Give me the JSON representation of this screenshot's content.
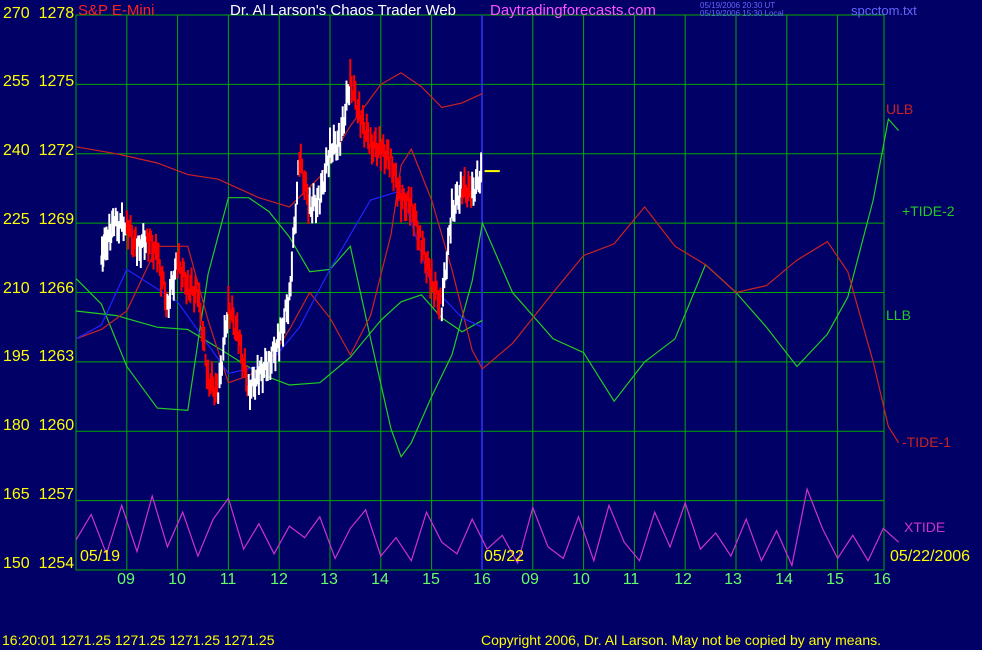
{
  "header": {
    "instrument": "S&P E-Mini",
    "title": "Dr. Al Larson's Chaos Trader Web",
    "site": "Daytradingforecasts.com",
    "stamp_line1": "05/19/2006 20:30 UT",
    "stamp_line2": "05/19/2006 15:30 Local",
    "file": "spcctom.txt"
  },
  "footer": {
    "status": "16:20:01  1271.25 1271.25 1271.25 1271.25",
    "copyright": "Copyright 2006, Dr. Al Larson. May not be copied by any means."
  },
  "colors": {
    "background": "#000066",
    "grid": "#00aa00",
    "axis_text": "#ffff00",
    "time_text": "#66ff66",
    "price_bar_up": "#ffffff",
    "price_bar_down": "#ff0000",
    "ulb": "#cc2222",
    "llb": "#22cc22",
    "tide_minus_1": "#cc2222",
    "tide_plus_2": "#22cc22",
    "xtide": "#cc33cc",
    "average": "#2222ff"
  },
  "chart_data": {
    "type": "line",
    "title": "Dr. Al Larson's Chaos Trader Web",
    "grid": true,
    "y_ticks": [
      {
        "osc": "270",
        "price": "1278"
      },
      {
        "osc": "255",
        "price": "1275"
      },
      {
        "osc": "240",
        "price": "1272"
      },
      {
        "osc": "225",
        "price": "1269"
      },
      {
        "osc": "210",
        "price": "1266"
      },
      {
        "osc": "195",
        "price": "1263"
      },
      {
        "osc": "180",
        "price": "1260"
      },
      {
        "osc": "165",
        "price": "1257"
      },
      {
        "osc": "150",
        "price": "1254"
      }
    ],
    "ylim_price": [
      1254,
      1278
    ],
    "x_ticks": [
      "09",
      "10",
      "11",
      "12",
      "13",
      "14",
      "15",
      "16",
      "09",
      "10",
      "11",
      "12",
      "13",
      "14",
      "15",
      "16"
    ],
    "dates": {
      "start": "05/19",
      "mid": "05/22",
      "end": "05/22/2006"
    },
    "right_labels": {
      "ulb": "ULB",
      "tide_plus_2": "+TIDE-2",
      "llb": "LLB",
      "tide_minus_1": "-TIDE-1",
      "xtide": "XTIDE"
    },
    "last_price": 1271.25,
    "price_close": {
      "hours": [
        8.5,
        8.6,
        8.75,
        9.0,
        9.2,
        9.4,
        9.6,
        9.8,
        10.0,
        10.2,
        10.4,
        10.6,
        10.8,
        11.0,
        11.2,
        11.4,
        11.6,
        11.8,
        12.0,
        12.2,
        12.4,
        12.6,
        12.8,
        13.0,
        13.2,
        13.4,
        13.6,
        13.8,
        14.0,
        14.2,
        14.4,
        14.6,
        14.8,
        15.0,
        15.2,
        15.4,
        15.6,
        15.8,
        16.0
      ],
      "prices": [
        1267.4,
        1268.2,
        1268.9,
        1269.0,
        1267.8,
        1268.4,
        1267.6,
        1265.5,
        1267.3,
        1266.3,
        1265.9,
        1262.3,
        1261.6,
        1265.5,
        1264.0,
        1261.8,
        1262.4,
        1263.0,
        1263.9,
        1265.8,
        1271.8,
        1269.7,
        1270.0,
        1272.2,
        1272.5,
        1275.2,
        1273.5,
        1272.4,
        1272.2,
        1271.7,
        1270.0,
        1269.8,
        1268.1,
        1266.5,
        1265.4,
        1269.5,
        1270.5,
        1270.3,
        1271.25
      ]
    },
    "series": [
      {
        "name": "ULB",
        "hours": [
          8.0,
          8.8,
          9.6,
          10.2,
          10.8,
          11.6,
          12.2,
          12.8,
          13.4,
          14.0,
          14.4,
          14.8,
          15.2,
          15.6,
          16.0
        ],
        "values": [
          1272.3,
          1272.0,
          1271.6,
          1271.1,
          1270.9,
          1270.1,
          1269.7,
          1271.0,
          1273.2,
          1275.0,
          1275.5,
          1274.9,
          1274.0,
          1274.2,
          1274.6
        ]
      },
      {
        "name": "LLB",
        "hours": [
          8.0,
          8.8,
          9.6,
          10.2,
          10.8,
          11.6,
          12.2,
          12.8,
          13.4,
          14.0,
          14.4,
          14.8,
          15.2,
          15.6,
          16.0
        ],
        "values": [
          1265.2,
          1265.0,
          1264.5,
          1264.4,
          1263.6,
          1262.5,
          1262.0,
          1262.1,
          1263.2,
          1264.8,
          1265.6,
          1265.9,
          1264.9,
          1264.3,
          1264.8
        ]
      },
      {
        "name": "+TIDE-2",
        "hours": [
          8.0,
          8.5,
          9.0,
          9.6,
          10.2,
          10.6,
          11.0,
          11.4,
          11.8,
          12.2,
          12.6,
          13.0,
          13.4,
          13.8,
          14.2,
          14.4,
          14.6,
          15.0,
          15.4,
          15.8,
          16.0,
          16.6,
          17.4,
          18.0,
          18.6,
          19.2,
          19.8,
          20.4,
          21.0,
          21.6,
          22.2,
          22.8,
          23.2,
          23.7,
          24.0,
          24.2
        ],
        "values": [
          1266.6,
          1265.5,
          1262.8,
          1261.0,
          1260.9,
          1266.8,
          1270.1,
          1270.1,
          1269.5,
          1268.4,
          1266.9,
          1267.0,
          1268.0,
          1264.0,
          1260.1,
          1258.9,
          1259.5,
          1261.5,
          1263.3,
          1266.5,
          1269.0,
          1266.0,
          1264.0,
          1263.4,
          1261.3,
          1263.0,
          1264.0,
          1267.2,
          1266.0,
          1264.5,
          1262.8,
          1264.2,
          1265.8,
          1270.0,
          1273.5,
          1273.0
        ]
      },
      {
        "name": "-TIDE-1",
        "hours": [
          8.0,
          8.5,
          9.0,
          9.6,
          10.2,
          10.6,
          11.0,
          11.4,
          11.8,
          12.2,
          12.6,
          13.0,
          13.4,
          13.8,
          14.2,
          14.4,
          14.6,
          15.0,
          15.4,
          15.8,
          16.0,
          16.6,
          17.4,
          18.0,
          18.6,
          19.2,
          19.8,
          20.4,
          21.0,
          21.6,
          22.2,
          22.8,
          23.2,
          23.7,
          24.0,
          24.2
        ],
        "values": [
          1264.0,
          1264.4,
          1265.2,
          1268.0,
          1268.0,
          1264.8,
          1262.1,
          1262.4,
          1263.0,
          1264.4,
          1266.0,
          1264.9,
          1263.3,
          1265.0,
          1268.5,
          1271.5,
          1272.2,
          1270.0,
          1267.0,
          1263.5,
          1262.7,
          1263.8,
          1266.0,
          1267.6,
          1268.1,
          1269.7,
          1268.0,
          1267.2,
          1266.0,
          1266.3,
          1267.4,
          1268.2,
          1266.9,
          1263.0,
          1260.2,
          1259.5
        ]
      },
      {
        "name": "XTIDE",
        "hours": [
          8.0,
          8.3,
          8.6,
          8.9,
          9.2,
          9.5,
          9.8,
          10.1,
          10.4,
          10.7,
          11.0,
          11.3,
          11.6,
          11.9,
          12.2,
          12.5,
          12.8,
          13.1,
          13.4,
          13.7,
          14.0,
          14.3,
          14.6,
          14.9,
          15.2,
          15.5,
          15.8,
          16.1,
          16.4,
          16.7,
          17.0,
          17.3,
          17.6,
          17.9,
          18.2,
          18.5,
          18.8,
          19.1,
          19.4,
          19.7,
          20.0,
          20.3,
          20.6,
          20.9,
          21.2,
          21.5,
          21.8,
          22.1,
          22.4,
          22.7,
          23.0,
          23.3,
          23.6,
          23.9,
          24.2
        ],
        "values": [
          1255.3,
          1256.4,
          1254.7,
          1256.8,
          1254.8,
          1257.2,
          1255.0,
          1256.5,
          1254.6,
          1256.2,
          1257.1,
          1254.9,
          1256.0,
          1254.7,
          1255.9,
          1255.4,
          1256.3,
          1254.5,
          1255.8,
          1256.6,
          1254.6,
          1255.4,
          1254.4,
          1256.5,
          1255.2,
          1254.7,
          1256.2,
          1254.9,
          1255.5,
          1254.3,
          1256.7,
          1255.0,
          1254.5,
          1256.3,
          1254.4,
          1256.8,
          1255.2,
          1254.4,
          1256.5,
          1255.0,
          1256.9,
          1254.9,
          1255.6,
          1254.6,
          1256.2,
          1254.4,
          1255.7,
          1254.2,
          1257.5,
          1255.8,
          1254.5,
          1255.5,
          1254.4,
          1255.8,
          1255.2
        ]
      },
      {
        "name": "",
        "hours": [
          8.0,
          8.5,
          9.0,
          10.0,
          11.0,
          11.8,
          12.4,
          13.0,
          13.8,
          14.4,
          15.0,
          15.6,
          16.0
        ],
        "values": [
          1264.0,
          1264.6,
          1267.0,
          1265.6,
          1262.5,
          1262.9,
          1264.5,
          1267.0,
          1270.0,
          1270.4,
          1266.3,
          1264.9,
          1264.5
        ]
      }
    ]
  }
}
